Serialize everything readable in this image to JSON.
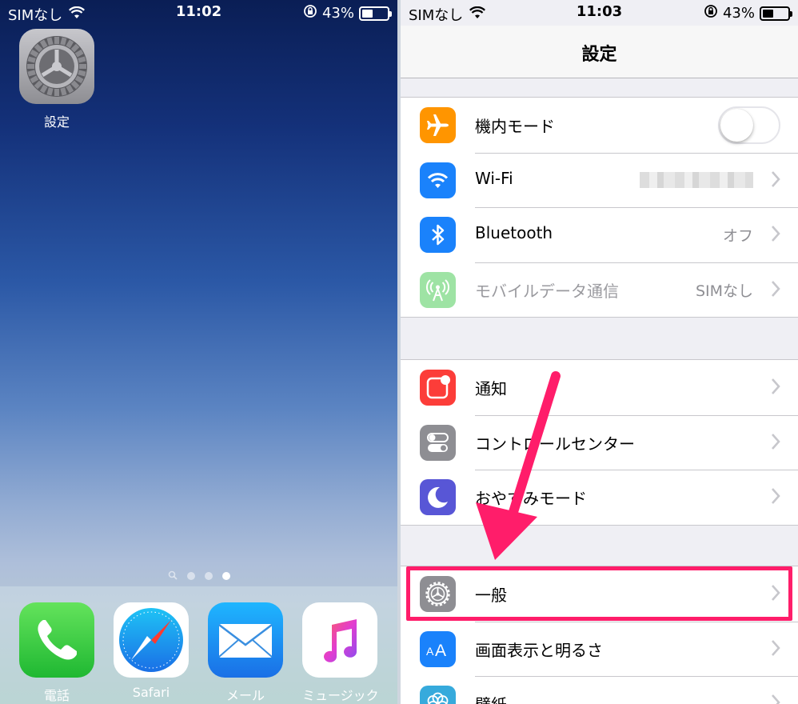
{
  "home": {
    "status": {
      "carrier": "SIMなし",
      "time": "11:02",
      "battery": "43%",
      "battery_level": 0.43
    },
    "apps": [
      {
        "label": "設定",
        "icon": "settings-gear-icon"
      }
    ],
    "dock": [
      {
        "label": "電話",
        "icon": "phone-icon"
      },
      {
        "label": "Safari",
        "icon": "safari-compass-icon"
      },
      {
        "label": "メール",
        "icon": "mail-envelope-icon"
      },
      {
        "label": "ミュージック",
        "icon": "music-note-icon"
      }
    ],
    "page_dots": {
      "count": 3,
      "active_index": 2
    }
  },
  "settings": {
    "status": {
      "carrier": "SIMなし",
      "time": "11:03",
      "battery": "43%",
      "battery_level": 0.43
    },
    "title": "設定",
    "groups": [
      [
        {
          "label": "機内モード",
          "icon": "airplane-icon",
          "icon_color": "#ff9500",
          "control": "toggle",
          "toggle_on": false
        },
        {
          "label": "Wi-Fi",
          "icon": "wifi-icon",
          "icon_color": "#1a82fb",
          "value": "",
          "value_redacted": true
        },
        {
          "label": "Bluetooth",
          "icon": "bluetooth-icon",
          "icon_color": "#1a82fb",
          "value": "オフ"
        },
        {
          "label": "モバイルデータ通信",
          "icon": "cellular-antenna-icon",
          "icon_color": "#9ee3a4",
          "value": "SIMなし",
          "disabled": true
        }
      ],
      [
        {
          "label": "通知",
          "icon": "notifications-icon",
          "icon_color": "#fc3d39"
        },
        {
          "label": "コントロールセンター",
          "icon": "control-center-icon",
          "icon_color": "#8e8e93"
        },
        {
          "label": "おやすみモード",
          "icon": "moon-icon",
          "icon_color": "#5856d6"
        }
      ],
      [
        {
          "label": "一般",
          "icon": "gear-icon",
          "icon_color": "#8e8e93",
          "highlighted": true
        },
        {
          "label": "画面表示と明るさ",
          "icon": "text-size-icon",
          "icon_color": "#1a82fb"
        },
        {
          "label": "壁紙",
          "icon": "wallpaper-flower-icon",
          "icon_color": "#36aadc"
        }
      ]
    ],
    "annotation_color": "#ff1d6a"
  }
}
